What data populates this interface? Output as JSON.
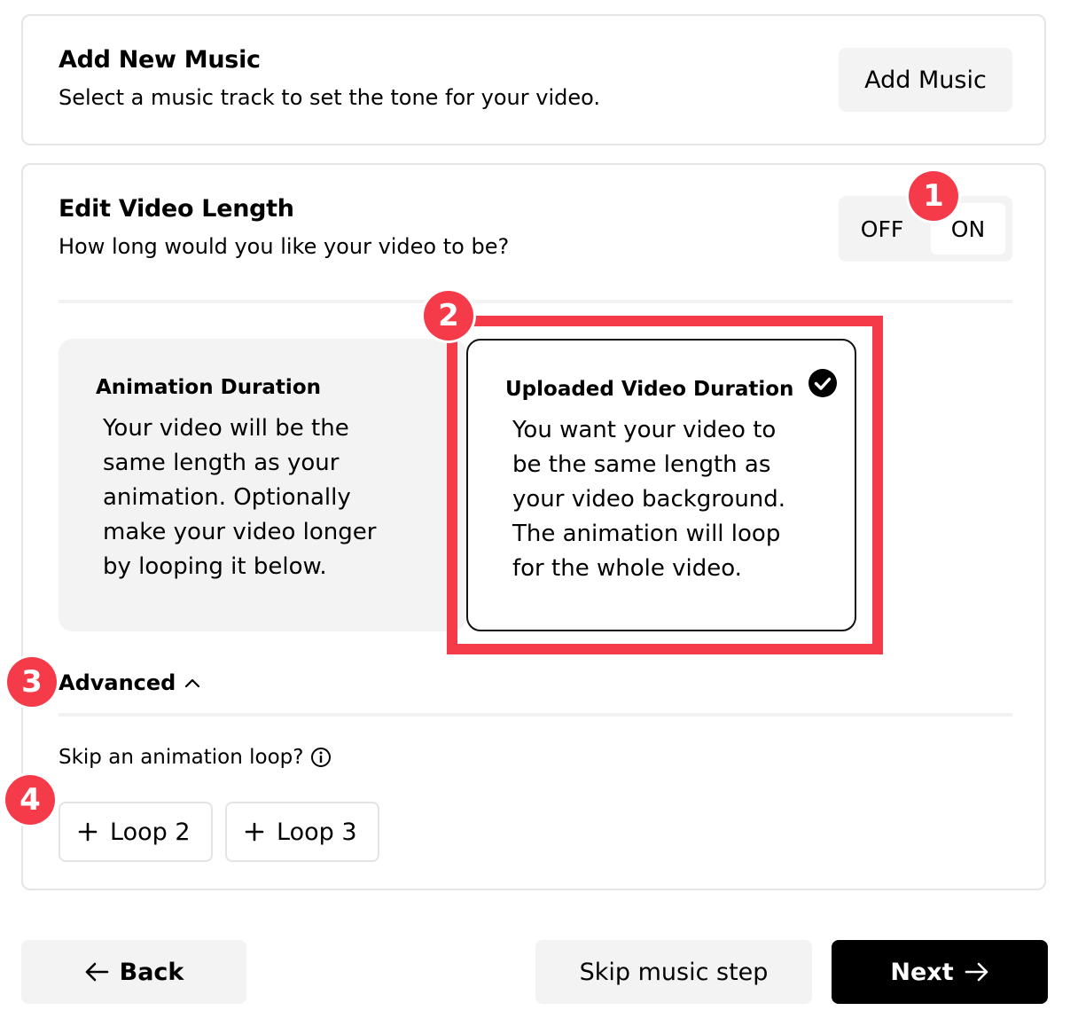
{
  "music": {
    "title": "Add New Music",
    "subtitle": "Select a music track to set the tone for your video.",
    "add_button": "Add Music"
  },
  "length": {
    "title": "Edit Video Length",
    "subtitle": "How long would you like your video to be?",
    "toggle": {
      "off_label": "OFF",
      "on_label": "ON",
      "selected": "ON"
    },
    "options": [
      {
        "title": "Animation Duration",
        "description": "Your video will be the\nsame length as your\nanimation. Optionally\nmake your video longer\nby looping it below.",
        "selected": false
      },
      {
        "title": "Uploaded Video Duration",
        "description": "You want your video to\nbe the same length as\nyour video background.\nThe animation will loop\nfor the whole video.",
        "selected": true
      }
    ],
    "advanced_label": "Advanced",
    "skip_question": "Skip an animation loop?",
    "loops": [
      "Loop 2",
      "Loop 3"
    ]
  },
  "annotations": [
    "1",
    "2",
    "3",
    "4"
  ],
  "footer": {
    "back_label": "Back",
    "skip_label": "Skip music step",
    "next_label": "Next"
  },
  "colors": {
    "annotation": "#f53b4a",
    "primary_button": "#000000",
    "secondary_button": "#f3f3f3"
  }
}
